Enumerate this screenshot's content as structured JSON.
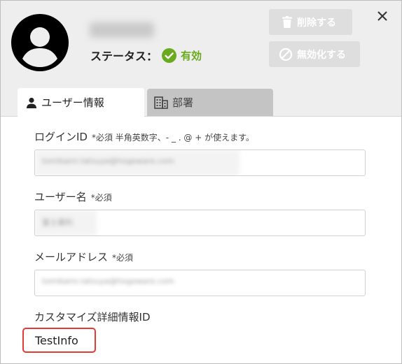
{
  "header": {
    "status_label": "ステータス：",
    "status_value": "有効",
    "delete_label": "削除する",
    "disable_label": "無効化する",
    "colors": {
      "status_green": "#6aaa1e",
      "disabled_button": "#dedede",
      "header_bg": "#eeeeee"
    }
  },
  "tabs": [
    {
      "label": "ユーザー情報",
      "icon": "person-icon",
      "active": true
    },
    {
      "label": "部署",
      "icon": "building-icon",
      "active": false
    }
  ],
  "fields": {
    "login_id": {
      "label": "ログインID",
      "note": "*必須 半角英数字、- _ . @ + が使えます。",
      "value": "tomikami.tatsuya@hogeware.com"
    },
    "username": {
      "label": "ユーザー名",
      "note": "*必須",
      "value": "富士康利"
    },
    "email": {
      "label": "メールアドレス",
      "note": "*必須",
      "value": "tomikami.tatsuya@hogeware.com"
    },
    "custom_id": {
      "label": "カスタマイズ詳細情報ID",
      "value": "TestInfo"
    }
  },
  "highlight_color": "#e53935"
}
